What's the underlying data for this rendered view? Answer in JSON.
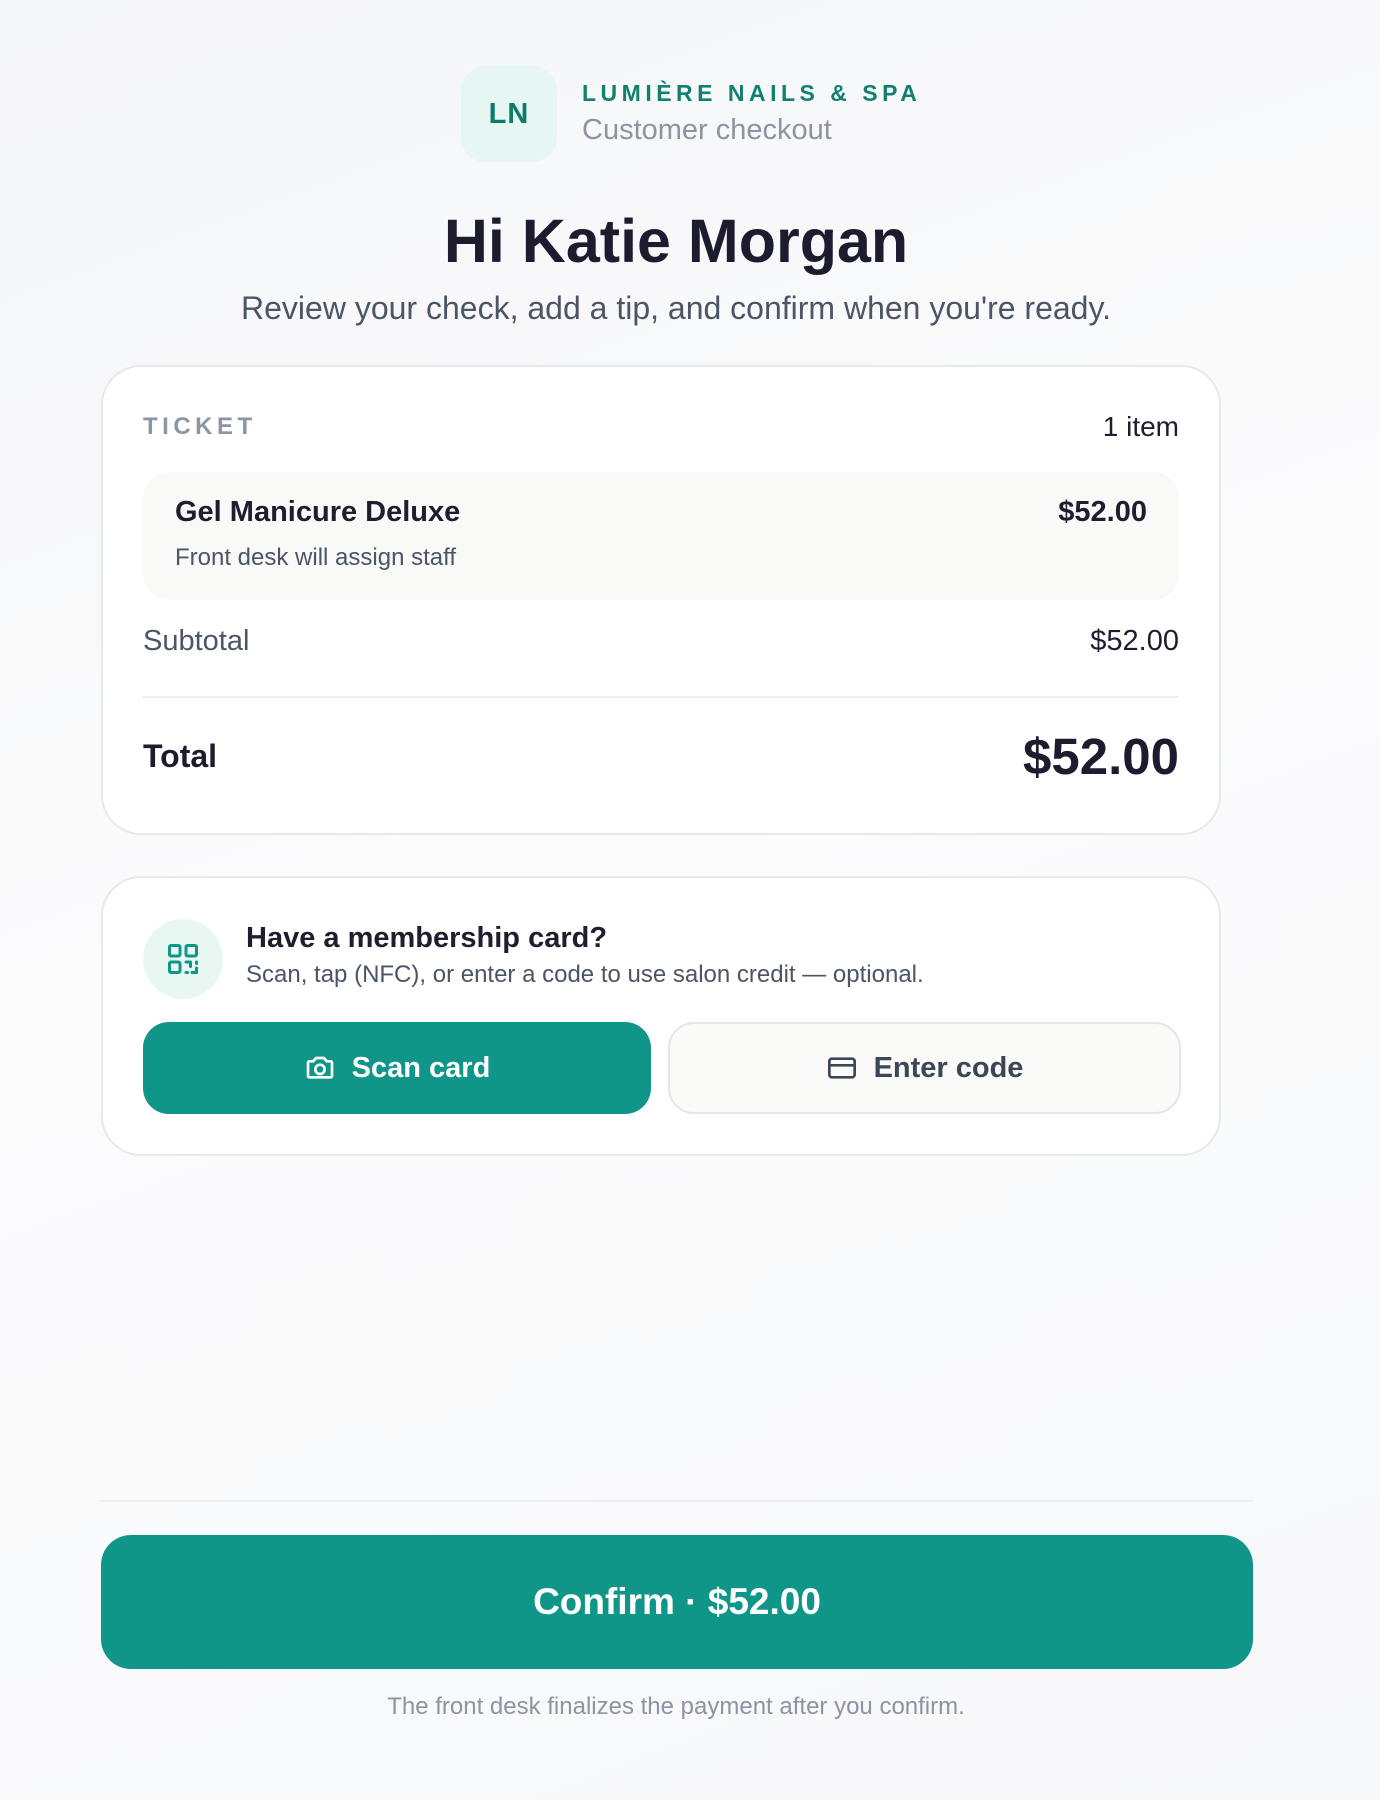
{
  "brand": {
    "logo_initials": "LN",
    "name": "LUMIÈRE NAILS & SPA",
    "subtitle": "Customer checkout"
  },
  "greeting": {
    "title": "Hi Katie Morgan",
    "subtitle": "Review your check, add a tip, and confirm when you're ready."
  },
  "ticket": {
    "label": "TICKET",
    "count": "1 item",
    "items": [
      {
        "name": "Gel Manicure Deluxe",
        "staff": "Front desk will assign staff",
        "price": "$52.00"
      }
    ],
    "subtotal_label": "Subtotal",
    "subtotal_value": "$52.00",
    "total_label": "Total",
    "total_value": "$52.00"
  },
  "membership": {
    "icon": "qr-code-icon",
    "title": "Have a membership card?",
    "description": "Scan, tap (NFC), or enter a code to use salon credit — optional.",
    "scan_label": "Scan card",
    "scan_icon": "camera-icon",
    "code_label": "Enter code",
    "code_icon": "credit-card-icon"
  },
  "confirm": {
    "label": "Confirm · $52.00"
  },
  "footnote": "The front desk finalizes the payment after you confirm.",
  "colors": {
    "accent": "#0f9688",
    "brand_text": "#12806f",
    "logo_bg": "#e6f7f3"
  }
}
